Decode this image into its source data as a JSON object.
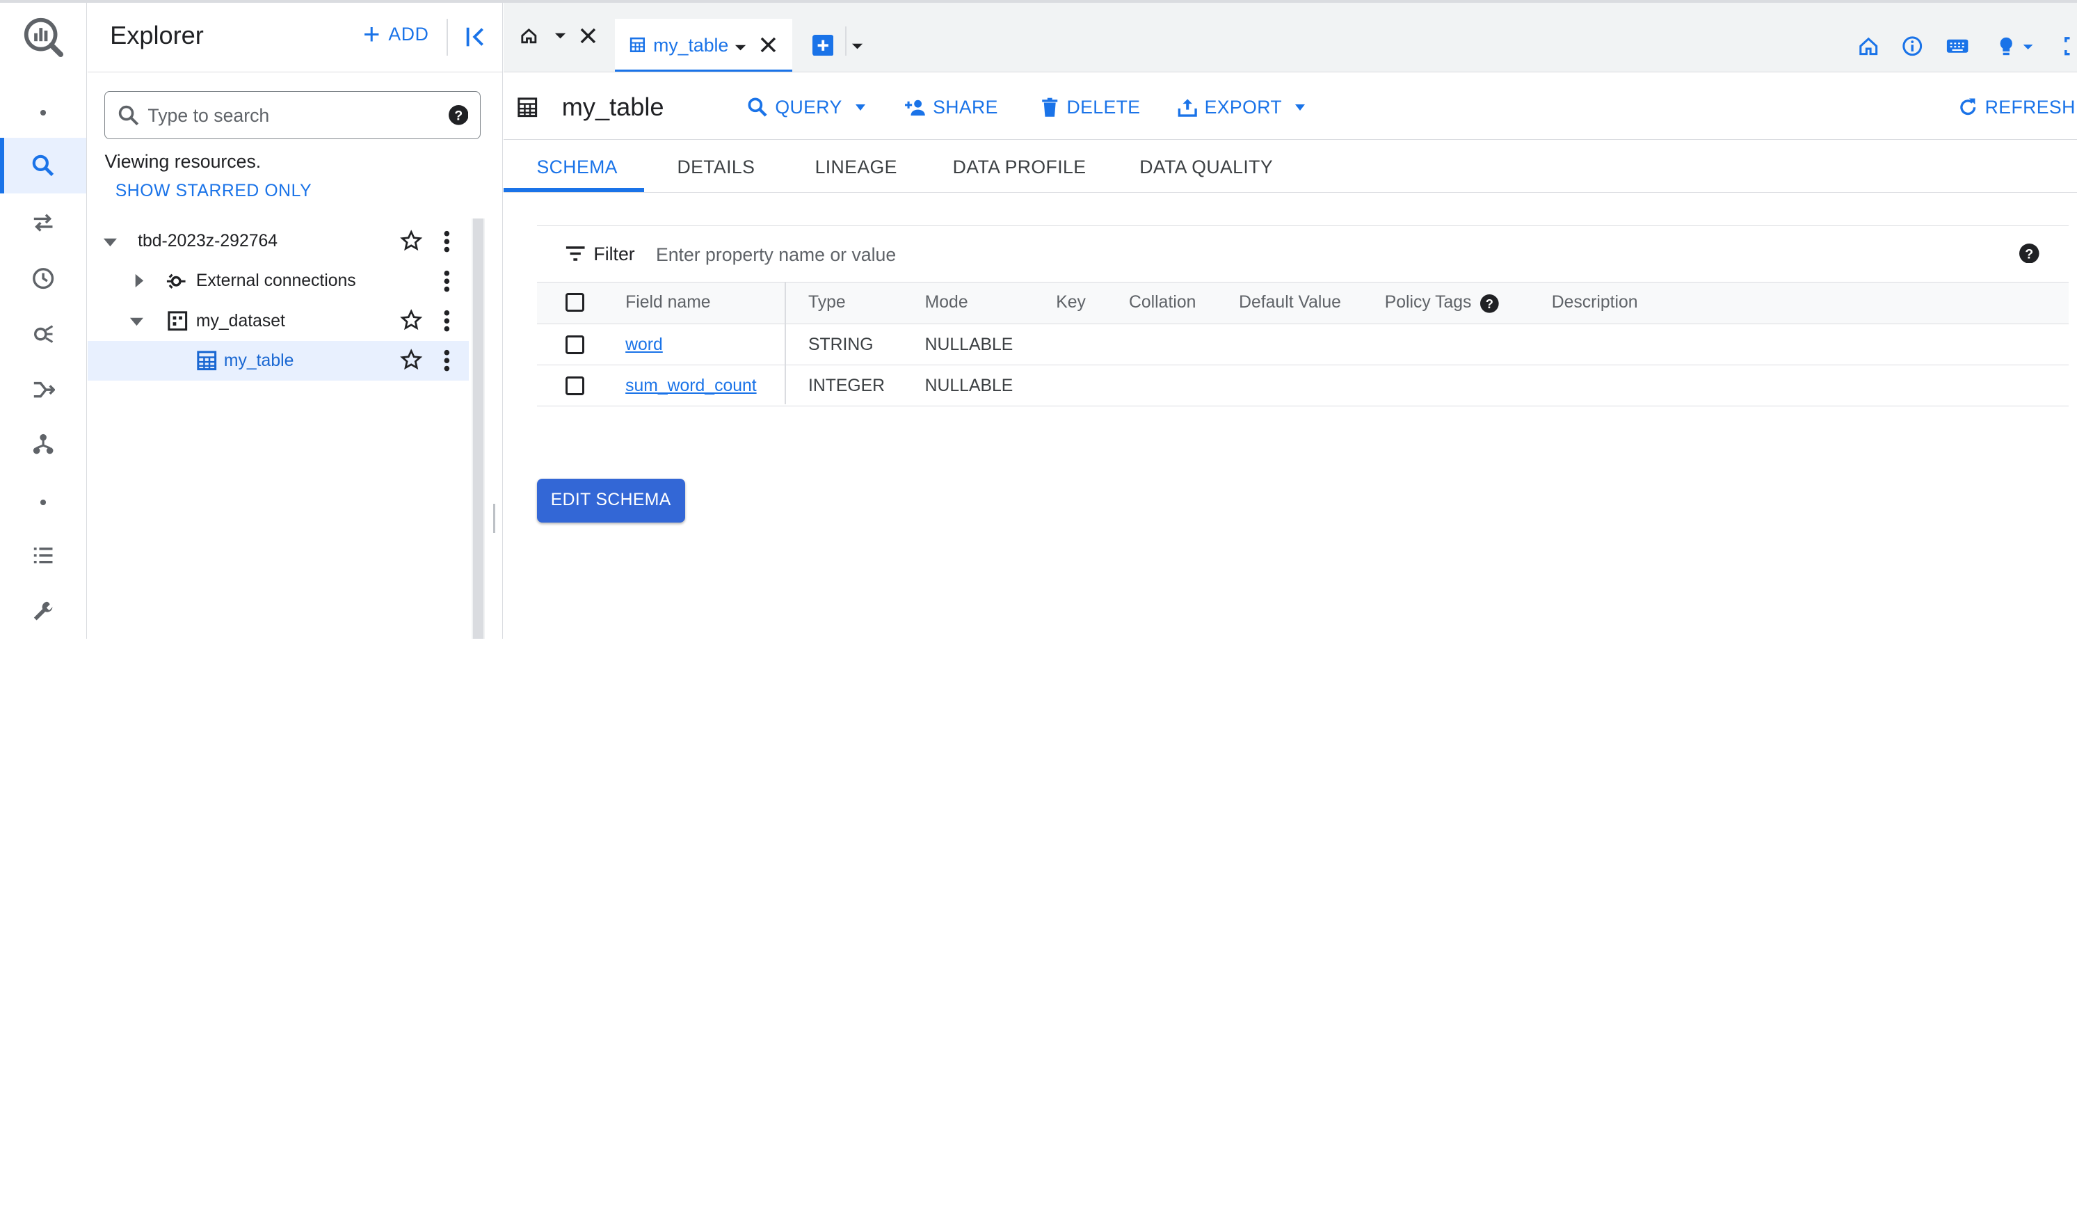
{
  "explorer": {
    "title": "Explorer",
    "add_label": "ADD",
    "search_placeholder": "Type to search",
    "viewing_text": "Viewing resources.",
    "show_starred_label": "SHOW STARRED ONLY",
    "tree": [
      {
        "label": "tbd-2023z-292764",
        "level": 0,
        "expanded": true,
        "icon": "project",
        "starred": false
      },
      {
        "label": "External connections",
        "level": 1,
        "expanded": false,
        "icon": "connection",
        "starred": null
      },
      {
        "label": "my_dataset",
        "level": 1,
        "expanded": true,
        "icon": "dataset",
        "starred": false
      },
      {
        "label": "my_table",
        "level": 2,
        "icon": "table",
        "starred": false,
        "selected": true
      }
    ]
  },
  "tabs": {
    "active_label": "my_table"
  },
  "titlebar": {
    "title": "my_table",
    "query_label": "QUERY",
    "share_label": "SHARE",
    "delete_label": "DELETE",
    "export_label": "EXPORT",
    "refresh_label": "REFRESH"
  },
  "subtabs": [
    "SCHEMA",
    "DETAILS",
    "LINEAGE",
    "DATA PROFILE",
    "DATA QUALITY"
  ],
  "filter": {
    "label": "Filter",
    "placeholder": "Enter property name or value"
  },
  "schema": {
    "columns": [
      "Field name",
      "Type",
      "Mode",
      "Key",
      "Collation",
      "Default Value",
      "Policy Tags",
      "Description"
    ],
    "rows": [
      {
        "field": "word",
        "type": "STRING",
        "mode": "NULLABLE"
      },
      {
        "field": "sum_word_count",
        "type": "INTEGER",
        "mode": "NULLABLE"
      }
    ]
  },
  "edit_schema_label": "EDIT SCHEMA",
  "colors": {
    "accent": "#1a73e8",
    "button": "#3367d6",
    "selected_bg": "#e8f0fe"
  }
}
